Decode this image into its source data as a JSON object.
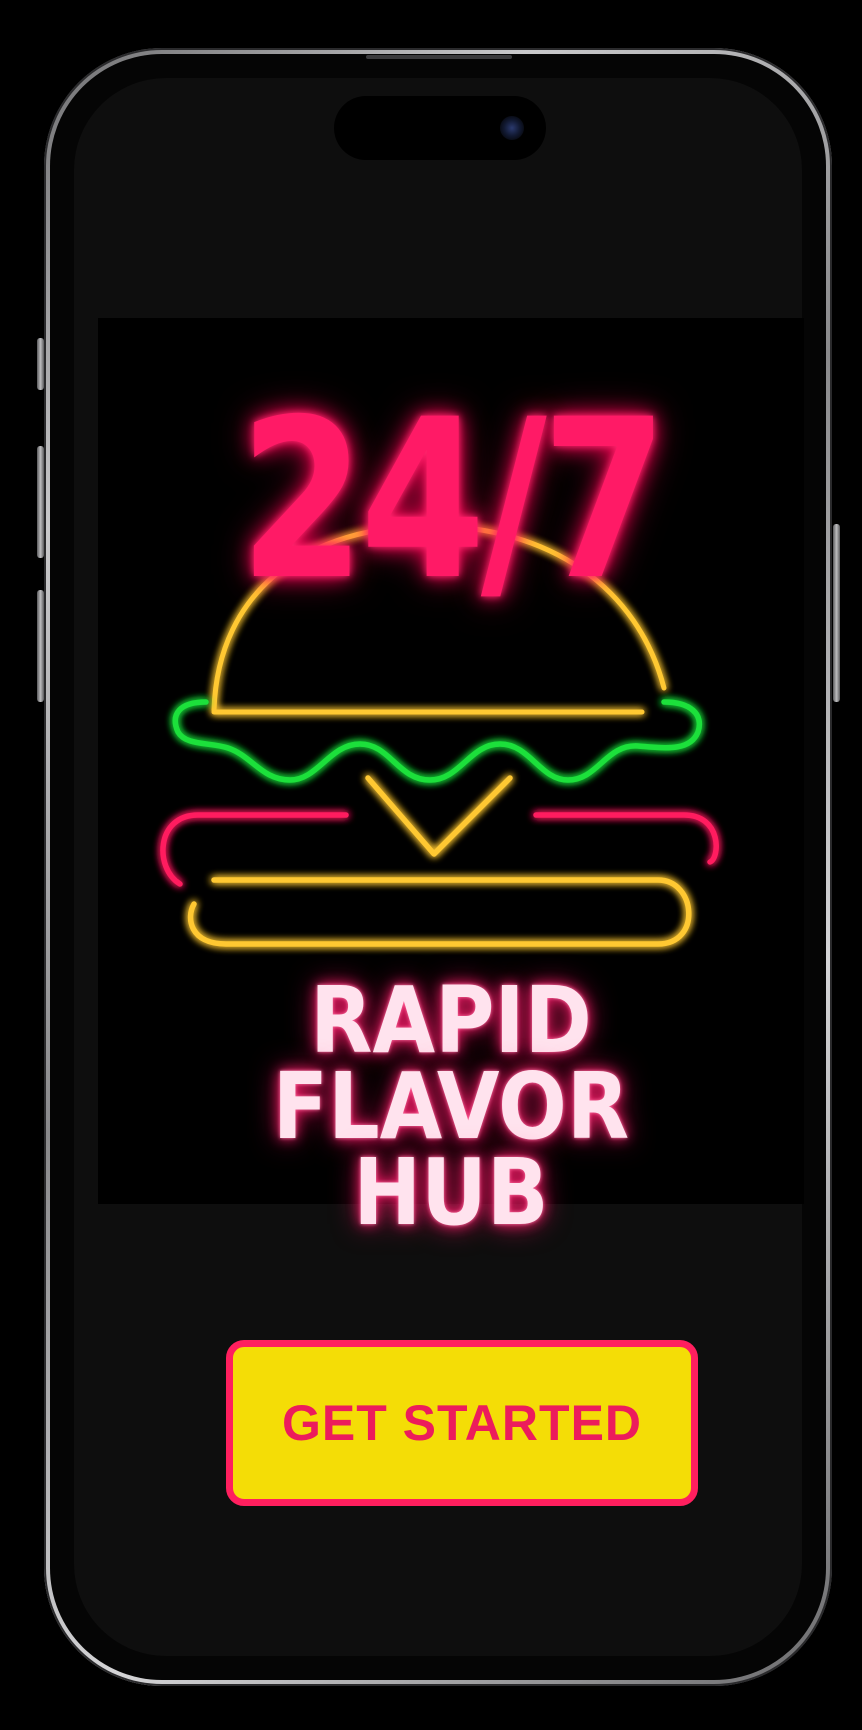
{
  "logo": {
    "headline": "24/7",
    "brand_name": "RAPID FLAVOR HUB",
    "illustration": "neon-burger-icon",
    "colors": {
      "headline": "#ff1a66",
      "bun": "#ffc832",
      "lettuce": "#1fe03a",
      "accent": "#ff1f5e",
      "brand_text": "#ffe3ee"
    }
  },
  "cta": {
    "label": "GET STARTED",
    "background": "#f4dd06",
    "border": "#ff1f5e",
    "text_color": "#ec1c5c"
  }
}
